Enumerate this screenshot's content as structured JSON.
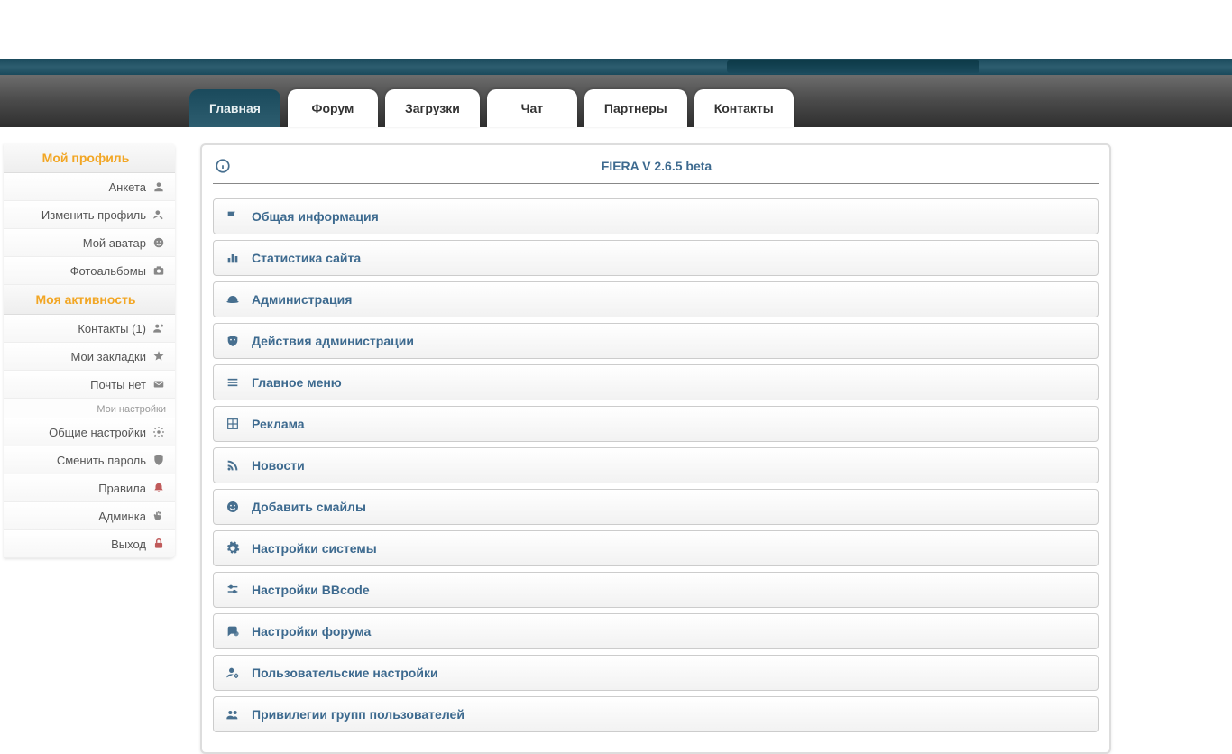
{
  "nav": {
    "active": "Главная",
    "tabs": [
      "Форум",
      "Загрузки",
      "Чат",
      "Партнеры",
      "Контакты"
    ]
  },
  "sidebar": {
    "section1_title": "Мой профиль",
    "section1_items": [
      {
        "label": "Анкета",
        "icon": "user"
      },
      {
        "label": "Изменить профиль",
        "icon": "user-edit"
      },
      {
        "label": "Мой аватар",
        "icon": "face"
      },
      {
        "label": "Фотоальбомы",
        "icon": "camera"
      }
    ],
    "section2_title": "Моя активность",
    "section2_items": [
      {
        "label": "Контакты (1)",
        "icon": "contacts"
      },
      {
        "label": "Мои закладки",
        "icon": "star"
      },
      {
        "label": "Почты нет",
        "icon": "mail"
      }
    ],
    "section3_title": "Мои настройки",
    "section3_items": [
      {
        "label": "Общие настройки",
        "icon": "gear"
      },
      {
        "label": "Сменить пароль",
        "icon": "shield"
      },
      {
        "label": "Правила",
        "icon": "bell"
      },
      {
        "label": "Админка",
        "icon": "hand"
      },
      {
        "label": "Выход",
        "icon": "lock"
      }
    ]
  },
  "panel": {
    "title": "FIERA V 2.6.5 beta",
    "items": [
      {
        "label": "Общая информация",
        "icon": "flag"
      },
      {
        "label": "Статистика сайта",
        "icon": "bars"
      },
      {
        "label": "Администрация",
        "icon": "helmet"
      },
      {
        "label": "Действия администрации",
        "icon": "mask"
      },
      {
        "label": "Главное меню",
        "icon": "menu"
      },
      {
        "label": "Реклама",
        "icon": "grid"
      },
      {
        "label": "Новости",
        "icon": "rss"
      },
      {
        "label": "Добавить смайлы",
        "icon": "smile"
      },
      {
        "label": "Настройки системы",
        "icon": "cog"
      },
      {
        "label": "Настройки BBcode",
        "icon": "sliders"
      },
      {
        "label": "Настройки форума",
        "icon": "chat"
      },
      {
        "label": "Пользовательские настройки",
        "icon": "user-cog"
      },
      {
        "label": "Привилегии групп пользователей",
        "icon": "group"
      }
    ]
  }
}
